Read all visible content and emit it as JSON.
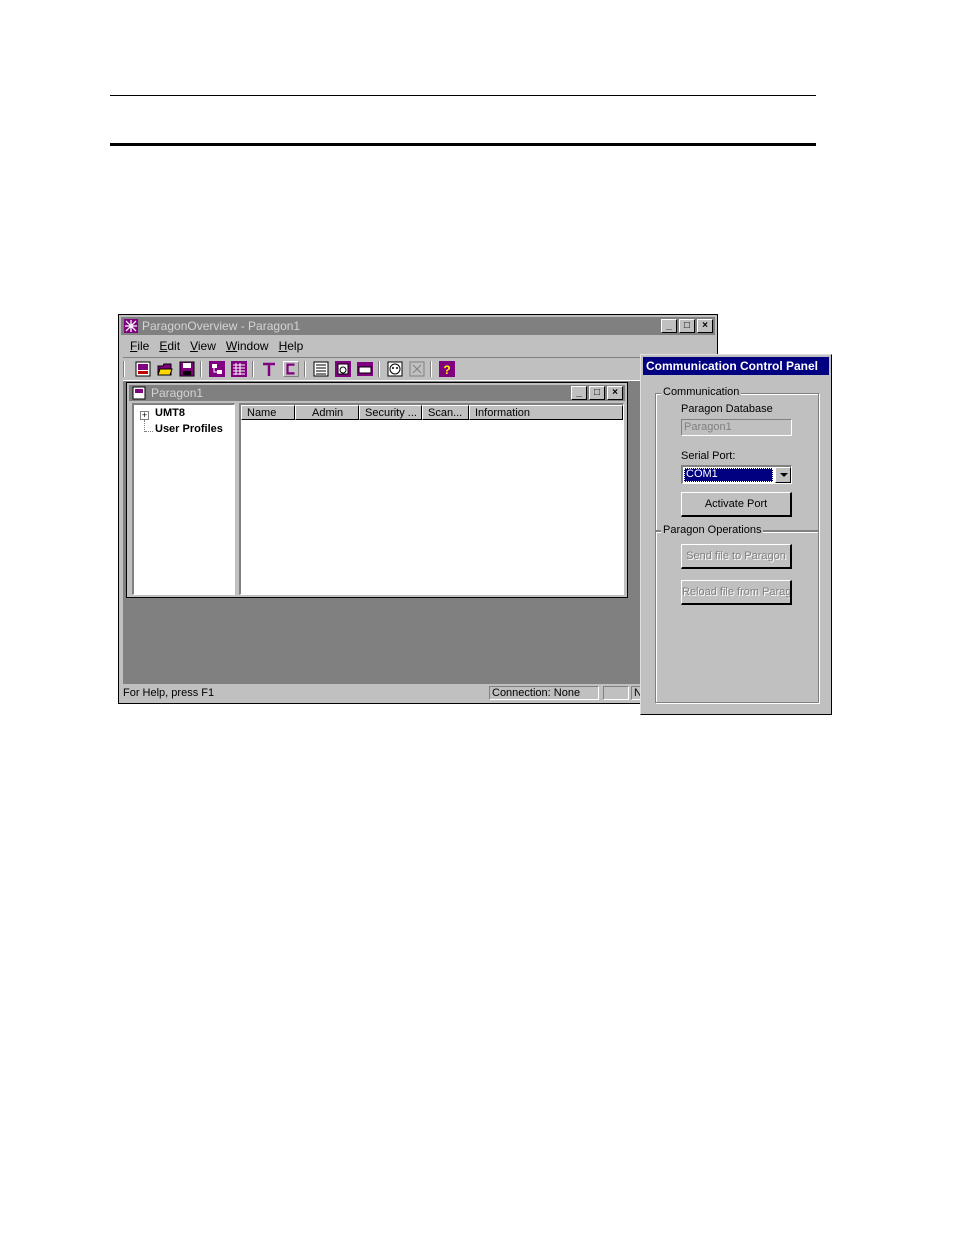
{
  "app": {
    "title": "ParagonOverview - Paragon1",
    "menu": [
      "File",
      "Edit",
      "View",
      "Window",
      "Help"
    ],
    "window_buttons": [
      "_",
      "□",
      "×"
    ]
  },
  "child": {
    "title": "Paragon1",
    "tree": {
      "root": "UMT8",
      "child": "User Profiles"
    },
    "columns": [
      "Name",
      "Admin",
      "Security ...",
      "Scan...",
      "Information"
    ]
  },
  "status": {
    "help": "For Help, press F1",
    "connection": "Connection: None",
    "pane3": "",
    "pane4": "N"
  },
  "ccp": {
    "title": "Communication Control Panel",
    "group1_label": "Communication",
    "db_label": "Paragon Database",
    "db_value": "Paragon1",
    "serial_label": "Serial Port:",
    "serial_value": "COM1",
    "activate": "Activate Port",
    "group2_label": "Paragon Operations",
    "send": "Send file to Paragon",
    "reload": "Reload file from Paragon"
  },
  "colors": {
    "titlebar_active": "#000080",
    "titlebar_inactive": "#808080",
    "face": "#c0c0c0",
    "toolbar_icon": "#800080"
  },
  "icons": [
    "app-icon",
    "db-new-icon",
    "open-folder-icon",
    "save-icon",
    "users-icon",
    "table-icon",
    "t-icon",
    "c-icon",
    "list-icon",
    "phone-icon",
    "keyboard-icon",
    "face-icon",
    "disabled-icon",
    "help-icon"
  ]
}
